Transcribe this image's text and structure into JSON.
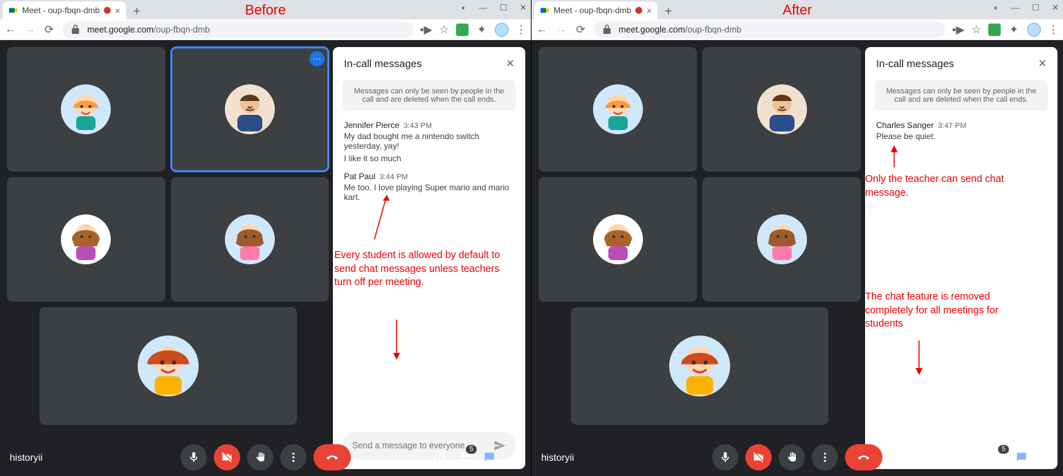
{
  "labels": {
    "before": "Before",
    "after": "After"
  },
  "browser": {
    "tab_title": "Meet - oup-fbqn-dmb",
    "url_host": "meet.google.com",
    "url_path": "/oup-fbqn-dmb"
  },
  "chat": {
    "title": "In-call messages",
    "notice": "Messages can only be seen by people in the call and are deleted when the call ends.",
    "input_placeholder": "Send a message to everyone"
  },
  "before_messages": [
    {
      "from": "Jennifer Pierce",
      "at": "3:43 PM",
      "lines": [
        "My dad bought me a nintendo switch yesterday, yay!",
        "I like it so much"
      ]
    },
    {
      "from": "Pat Paul",
      "at": "3:44 PM",
      "lines": [
        "Me too. I love playing Super mario and mario kart."
      ]
    }
  ],
  "after_messages": [
    {
      "from": "Charles Sanger",
      "at": "3:47 PM",
      "lines": [
        "Please be quiet."
      ]
    }
  ],
  "annotations": {
    "before_main": "Every student is allowed by default to send chat messages unless teachers turn off per meeting.",
    "after_top": "Only the teacher can send chat message.",
    "after_bottom": "The chat feature is removed completely for all meetings for students"
  },
  "bottom": {
    "meeting_name": "historyii",
    "participant_count": "5"
  }
}
